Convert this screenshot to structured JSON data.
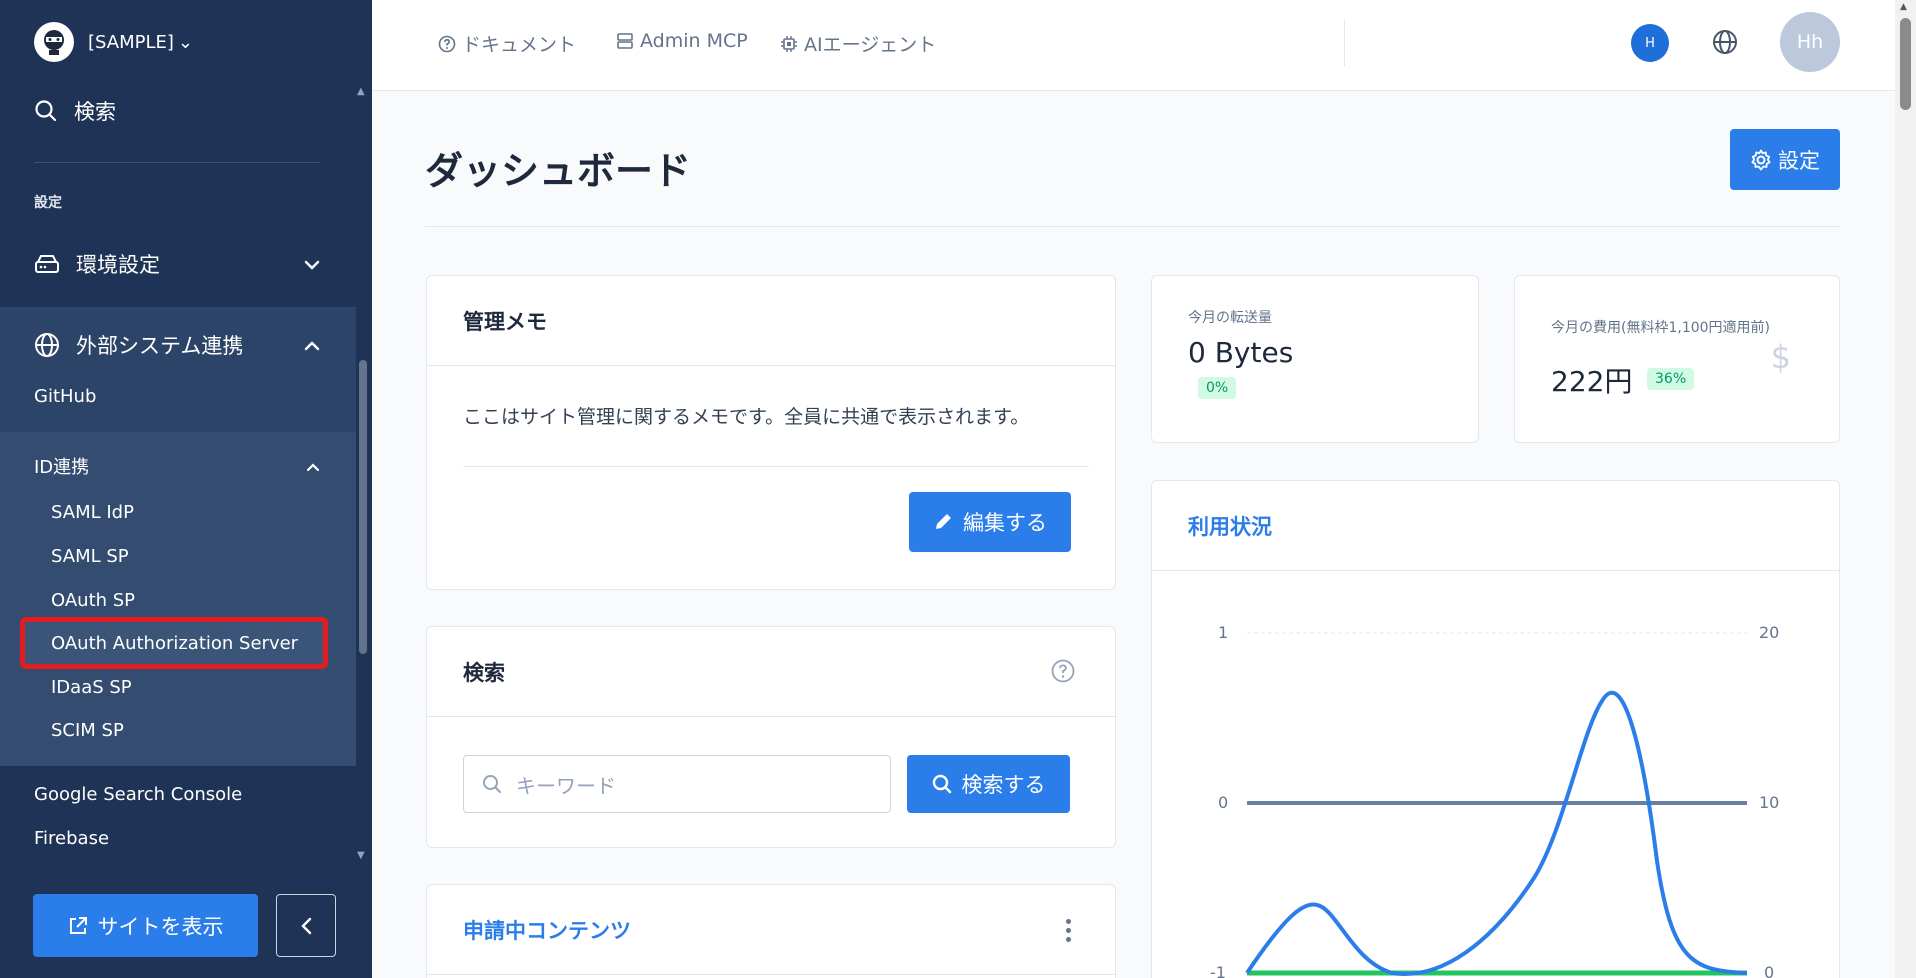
{
  "sidebar": {
    "brand_name": "[SAMPLE]",
    "search_label": "検索",
    "section_label": "設定",
    "env_settings": "環境設定",
    "external_integration": "外部システム連携",
    "github": "GitHub",
    "id_integration": "ID連携",
    "id_items": [
      "SAML IdP",
      "SAML SP",
      "OAuth SP",
      "OAuth Authorization Server",
      "IDaaS SP",
      "SCIM SP"
    ],
    "google_search_console": "Google Search Console",
    "firebase": "Firebase",
    "view_site": "サイトを表示"
  },
  "topbar": {
    "docs": "ドキュメント",
    "admin_mcp": "Admin MCP",
    "ai_agent": "AIエージェント",
    "small_avatar": "H",
    "avatar": "Hh"
  },
  "main": {
    "title": "ダッシュボード",
    "settings": "設定",
    "memo": {
      "title": "管理メモ",
      "text": "ここはサイト管理に関するメモです。全員に共通で表示されます。",
      "edit": "編集する"
    },
    "search": {
      "title": "検索",
      "placeholder": "キーワード",
      "button": "検索する"
    },
    "pending": {
      "title": "申請中コンテンツ"
    },
    "transfer": {
      "label": "今月の転送量",
      "value": "0 Bytes",
      "badge": "0%"
    },
    "cost": {
      "label": "今月の費用(無料枠1,100円適用前)",
      "value": "222円",
      "badge": "36%"
    },
    "usage": {
      "title": "利用状況",
      "left_ticks": [
        "1",
        "0",
        "-1"
      ],
      "right_ticks": [
        "20",
        "10",
        "0"
      ]
    }
  },
  "colors": {
    "sidebar_bg": "#1e3356",
    "accent": "#2b7de9",
    "selected_outline": "#e11d1d"
  }
}
